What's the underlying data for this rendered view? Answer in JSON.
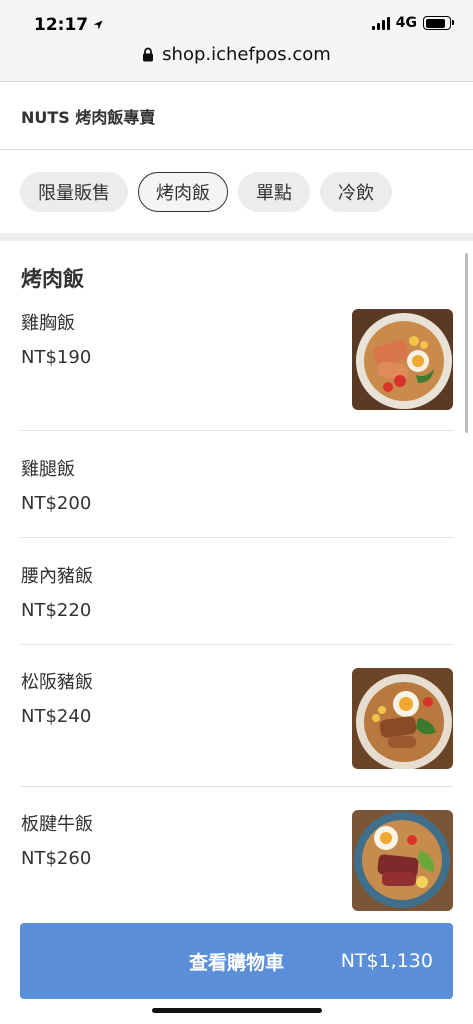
{
  "status_bar": {
    "time": "12:17",
    "network": "4G",
    "battery_level": 0.85
  },
  "browser": {
    "url": "shop.ichefpos.com"
  },
  "store": {
    "name": "NUTS 烤肉飯專賣"
  },
  "categories": [
    {
      "label": "限量販售",
      "active": false
    },
    {
      "label": "烤肉飯",
      "active": true
    },
    {
      "label": "單點",
      "active": false
    },
    {
      "label": "冷飲",
      "active": false
    }
  ],
  "menu": {
    "section_title": "烤肉飯",
    "items": [
      {
        "name": "雞胸飯",
        "price": "NT$190",
        "has_image": true
      },
      {
        "name": "雞腿飯",
        "price": "NT$200",
        "has_image": false
      },
      {
        "name": "腰內豬飯",
        "price": "NT$220",
        "has_image": false
      },
      {
        "name": "松阪豬飯",
        "price": "NT$240",
        "has_image": true
      },
      {
        "name": "板腱牛飯",
        "price": "NT$260",
        "has_image": true
      }
    ]
  },
  "cart": {
    "label": "查看購物車",
    "total": "NT$1,130",
    "color": "#5b8fd8"
  }
}
